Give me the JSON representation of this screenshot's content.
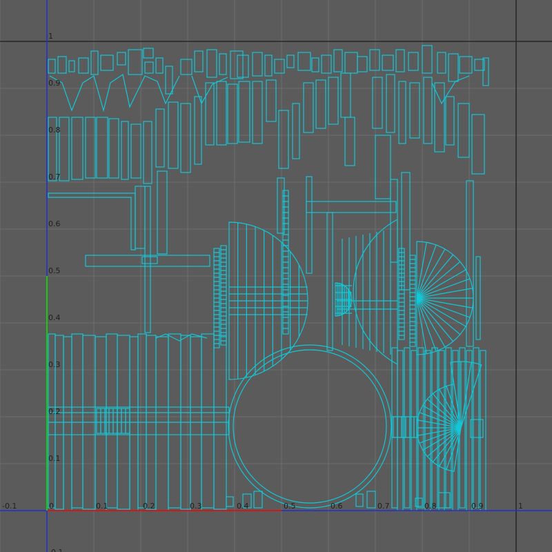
{
  "viewport": {
    "kind": "uv-texture-editor",
    "range_u": [
      -0.1,
      1.0
    ],
    "range_v": [
      -0.1,
      1.0
    ],
    "grid_step": 0.1
  },
  "axes": {
    "u_tick_labels": [
      "-0.1",
      "0",
      "0.1",
      "0.2",
      "0.3",
      "0.4",
      "0.5",
      "0.6",
      "0.7",
      "0.8",
      "0.9",
      "1"
    ],
    "v_tick_labels": [
      "-0.1",
      "0.1",
      "0.2",
      "0.3",
      "0.4",
      "0.5",
      "0.6",
      "0.7",
      "0.8",
      "0.9",
      "1"
    ]
  },
  "colors": {
    "background": "#5b5b5b",
    "grid_minor": "#6e6e6e",
    "grid_unit": "#262626",
    "uv_wire": "#12c8d8",
    "axis_u": "#1f2fd0",
    "axis_v": "#1f2fd0",
    "axis_u_highlight": "#d01818",
    "axis_v_highlight": "#18c818"
  },
  "icons": [
    "uv-shell-wireframe-icon"
  ]
}
